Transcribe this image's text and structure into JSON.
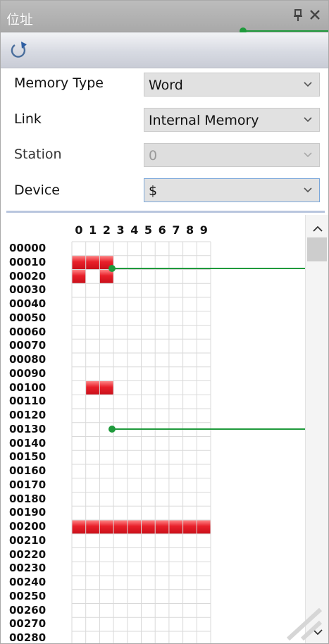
{
  "window": {
    "title": "位址",
    "pin_icon": "pin-icon",
    "close_icon": "close-icon"
  },
  "toolbar": {
    "refresh_icon": "refresh-icon"
  },
  "form": {
    "memory_type": {
      "label": "Memory Type",
      "value": "Word"
    },
    "link": {
      "label": "Link",
      "value": "Internal Memory"
    },
    "station": {
      "label": "Station",
      "value": "0",
      "enabled": false
    },
    "device": {
      "label": "Device",
      "value": "$"
    }
  },
  "grid": {
    "columns": [
      "0",
      "1",
      "2",
      "3",
      "4",
      "5",
      "6",
      "7",
      "8",
      "9"
    ],
    "addresses": [
      "00000",
      "00010",
      "00020",
      "00030",
      "00040",
      "00050",
      "00060",
      "00070",
      "00080",
      "00090",
      "00100",
      "00110",
      "00120",
      "00130",
      "00140",
      "00150",
      "00160",
      "00170",
      "00180",
      "00190",
      "00200",
      "00210",
      "00220",
      "00230",
      "00240",
      "00250",
      "00260",
      "00270",
      "00280"
    ],
    "used_cells": [
      [
        1,
        0
      ],
      [
        1,
        1
      ],
      [
        1,
        2
      ],
      [
        2,
        0
      ],
      [
        2,
        2
      ],
      [
        10,
        1
      ],
      [
        10,
        2
      ],
      [
        20,
        0
      ],
      [
        20,
        1
      ],
      [
        20,
        2
      ],
      [
        20,
        3
      ],
      [
        20,
        4
      ],
      [
        20,
        5
      ],
      [
        20,
        6
      ],
      [
        20,
        7
      ],
      [
        20,
        8
      ],
      [
        20,
        9
      ]
    ],
    "used_color": "#e8202a"
  },
  "colors": {
    "callout": "#1f9a3c",
    "titlebar": "#b3b3b3",
    "grid_line": "#d9d9d9"
  }
}
